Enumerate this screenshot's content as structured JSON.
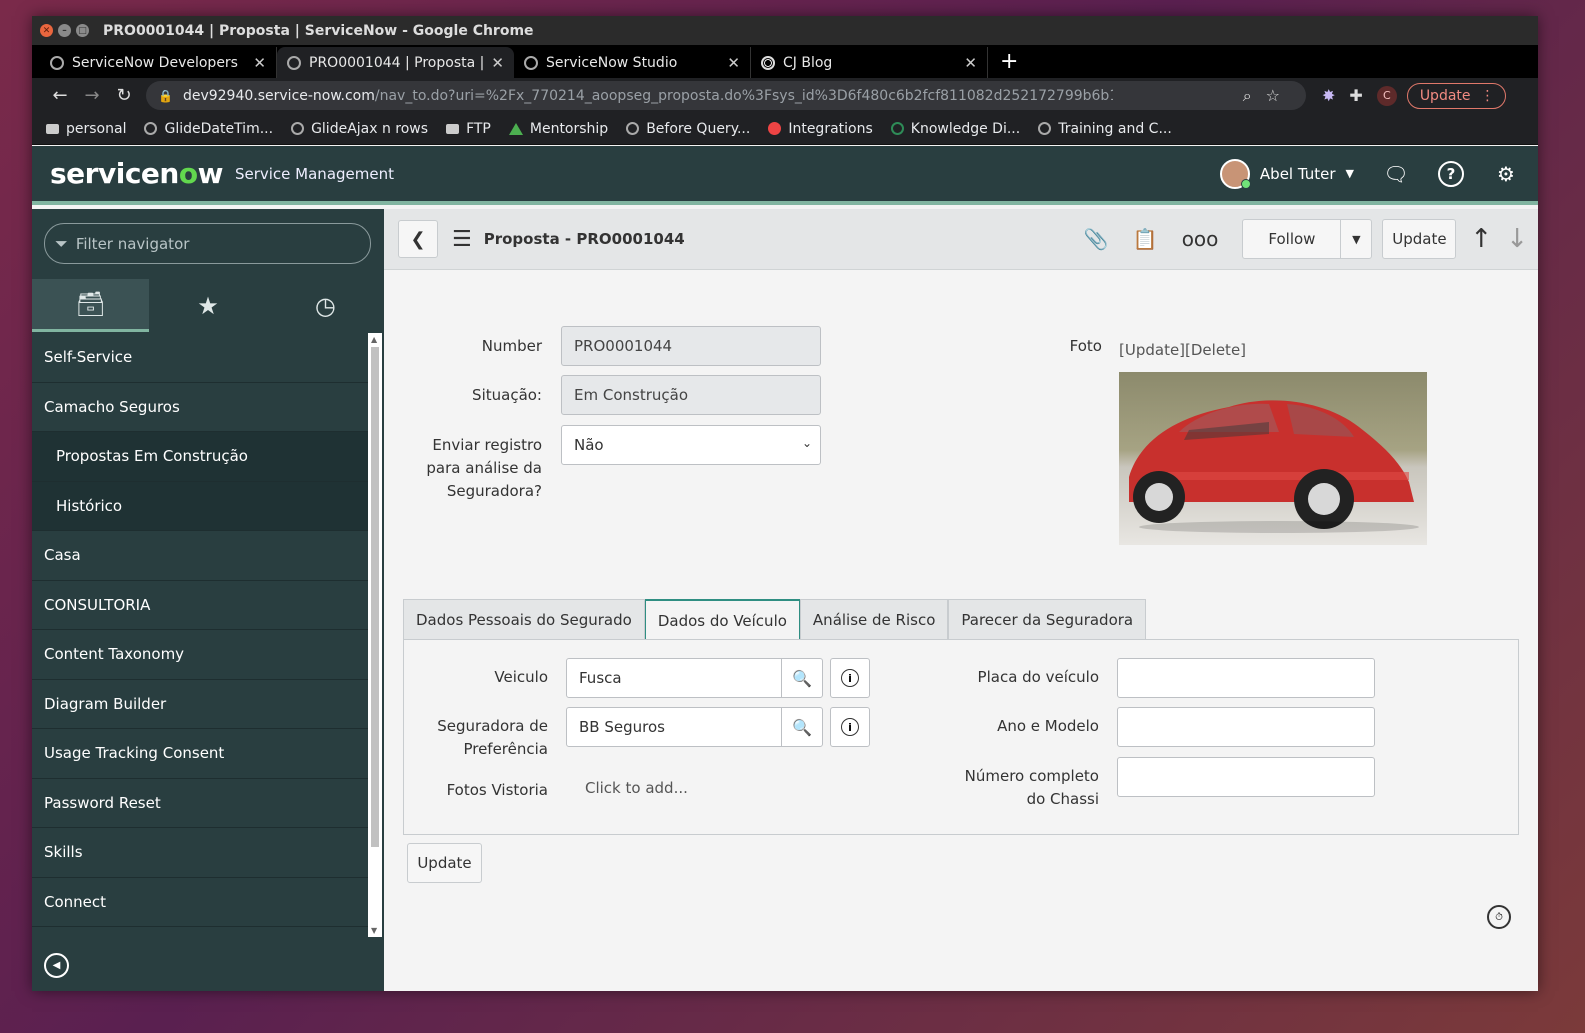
{
  "browser": {
    "window_title": "PRO0001044 | Proposta | ServiceNow - Google Chrome",
    "tabs": [
      {
        "label": "ServiceNow Developers",
        "icon": "servicenow-favicon"
      },
      {
        "label": "PRO0001044 | Proposta | S",
        "icon": "servicenow-favicon"
      },
      {
        "label": "ServiceNow Studio",
        "icon": "servicenow-favicon"
      },
      {
        "label": "CJ Blog",
        "icon": "globe-favicon"
      }
    ],
    "url_host": "dev92940.service-now.com",
    "url_path": "/nav_to.do?uri=%2Fx_770214_aoopseg_proposta.do%3Fsys_id%3D6f480c6b2fcf811082d252172799b6b1%26sysparm_record_target%3Dx_770...",
    "profile_initial": "C",
    "update_label": "Update",
    "bookmarks": [
      {
        "label": "personal",
        "icon": "folder"
      },
      {
        "label": "GlideDateTim...",
        "icon": "servicenow"
      },
      {
        "label": "GlideAjax n rows",
        "icon": "servicenow"
      },
      {
        "label": "FTP",
        "icon": "folder"
      },
      {
        "label": "Mentorship",
        "icon": "drive"
      },
      {
        "label": "Before Query...",
        "icon": "servicenow"
      },
      {
        "label": "Integrations",
        "icon": "gear-red"
      },
      {
        "label": "Knowledge Di...",
        "icon": "servicenow-green"
      },
      {
        "label": "Training and C...",
        "icon": "servicenow"
      }
    ]
  },
  "header": {
    "logo": "servicenow",
    "app_name": "Service Management",
    "user_name": "Abel Tuter"
  },
  "nav": {
    "filter_placeholder": "Filter navigator",
    "items": [
      {
        "label": "Self-Service",
        "sub": false
      },
      {
        "label": "Camacho Seguros",
        "sub": false
      },
      {
        "label": "Propostas Em Construção",
        "sub": true
      },
      {
        "label": "Histórico",
        "sub": true
      },
      {
        "label": "Casa",
        "sub": false
      },
      {
        "label": "CONSULTORIA",
        "sub": false
      },
      {
        "label": "Content Taxonomy",
        "sub": false
      },
      {
        "label": "Diagram Builder",
        "sub": false
      },
      {
        "label": "Usage Tracking Consent",
        "sub": false
      },
      {
        "label": "Password Reset",
        "sub": false
      },
      {
        "label": "Skills",
        "sub": false
      },
      {
        "label": "Connect",
        "sub": false
      }
    ]
  },
  "form": {
    "title": "Proposta - PRO0001044",
    "follow_label": "Follow",
    "update_label": "Update",
    "number_label": "Number",
    "number_value": "PRO0001044",
    "situacao_label": "Situação:",
    "situacao_value": "Em Construção",
    "enviar_label": "Enviar registro para análise da Seguradora?",
    "enviar_value": "Não",
    "foto_label": "Foto",
    "foto_update": "[Update]",
    "foto_delete": "[Delete]",
    "tabs": [
      "Dados Pessoais do Segurado",
      "Dados do Veículo",
      "Análise de Risco",
      "Parecer da Seguradora"
    ],
    "active_tab": 1,
    "veiculo_label": "Veiculo",
    "veiculo_value": "Fusca",
    "seguradora_label": "Seguradora de Preferência",
    "seguradora_value": "BB Seguros",
    "fotos_label": "Fotos Vistoria",
    "fotos_click": "Click to add...",
    "placa_label": "Placa do veículo",
    "placa_value": "",
    "ano_label": "Ano e Modelo",
    "ano_value": "",
    "chassi_label": "Número completo do Chassi",
    "chassi_value": "",
    "bottom_update": "Update"
  },
  "colors": {
    "header_bg": "#293e40",
    "accent": "#81b5a1",
    "logo_o": "#62d84e"
  }
}
